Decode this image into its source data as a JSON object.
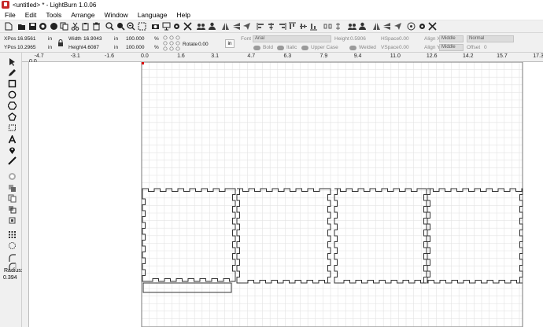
{
  "window": {
    "title": "<untitled> * - LightBurn 1.0.06"
  },
  "menu": [
    "File",
    "Edit",
    "Tools",
    "Arrange",
    "Window",
    "Language",
    "Help"
  ],
  "toolbar_icons": [
    "new-file-icon",
    "open-folder-icon",
    "save-icon",
    "color-wheel-icon",
    "circle-icon",
    "copy-icon",
    "cut-icon",
    "paste-icon",
    "delete-icon",
    "zoom-in-icon",
    "zoom-fit-icon",
    "zoom-out-icon",
    "zoom-frame-icon",
    "camera-icon",
    "monitor-icon",
    "settings-gear-icon",
    "tools-icon",
    "group-icon",
    "person-icon",
    "mirror-horizontal-icon",
    "mirror-vertical-icon",
    "send-icon",
    "align-left-icon",
    "align-center-icon",
    "align-right-icon",
    "align-top-icon",
    "align-middle-icon",
    "align-bottom-icon",
    "distribute-h-icon",
    "distribute-v-icon",
    "group-icon-2",
    "person-icon-2",
    "mirror-icon-2",
    "mirror-icon-3",
    "send-icon-2",
    "target-icon",
    "settings-icon-2",
    "tools-icon-2"
  ],
  "properties": {
    "xpos_label": "XPos",
    "xpos_value": "16.9561",
    "ypos_label": "YPos",
    "ypos_value": "10.2965",
    "unit": "in",
    "width_label": "Width",
    "width_value": "16.9043",
    "height_label": "Height",
    "height_value": "4.6087",
    "scale_x": "100.000",
    "scale_y": "100.000",
    "percent": "%",
    "rotate_label": "Rotate",
    "rotate_value": "0.00",
    "font_label": "Font",
    "font_value": "Arial",
    "text_height_label": "Height",
    "text_height_value": "0.5906",
    "hspace_label": "HSpace",
    "hspace_value": "0.00",
    "vspace_label": "VSpace",
    "vspace_value": "0.00",
    "align_x_label": "Align X",
    "align_x_value": "Middle",
    "align_y_label": "Align Y",
    "align_y_value": "Middle",
    "normal_value": "Normal",
    "offset_label": "Offset",
    "offset_value": "0",
    "bold_label": "Bold",
    "italic_label": "Italic",
    "upper_case_label": "Upper Case",
    "welded_label": "Welded"
  },
  "left_tools": [
    "select-arrow-icon",
    "pencil-icon",
    "rectangle-icon",
    "ellipse-icon",
    "polygon-icon",
    "pentagon-icon",
    "dotted-rect-icon",
    "text-tool-icon",
    "position-pin-icon",
    "measure-icon",
    "offset-icon",
    "copy-stack-icon",
    "duplicate-icon",
    "boolean-icon",
    "square-small-icon",
    "grid-array-icon",
    "circular-array-icon",
    "corner-icon",
    "radius-icon"
  ],
  "radius": {
    "label": "Radius:",
    "value": "0.394"
  },
  "ruler_top": [
    "-4.7",
    "-3.1",
    "-1.6",
    "0.0",
    "1.6",
    "3.1",
    "4.7",
    "6.3",
    "7.9",
    "9.4",
    "11.0",
    "12.6",
    "14.2",
    "15.7",
    "17.3"
  ],
  "ruler_left": [
    "0.0",
    "1.6",
    "3.1",
    "4.7",
    "6.3",
    "7.9",
    "9.4",
    "11.0"
  ],
  "colors": {
    "grid": "#e3e3e3",
    "shape": "#333333",
    "origin": "#dd0000",
    "bed_border": "#7a7a7a"
  }
}
